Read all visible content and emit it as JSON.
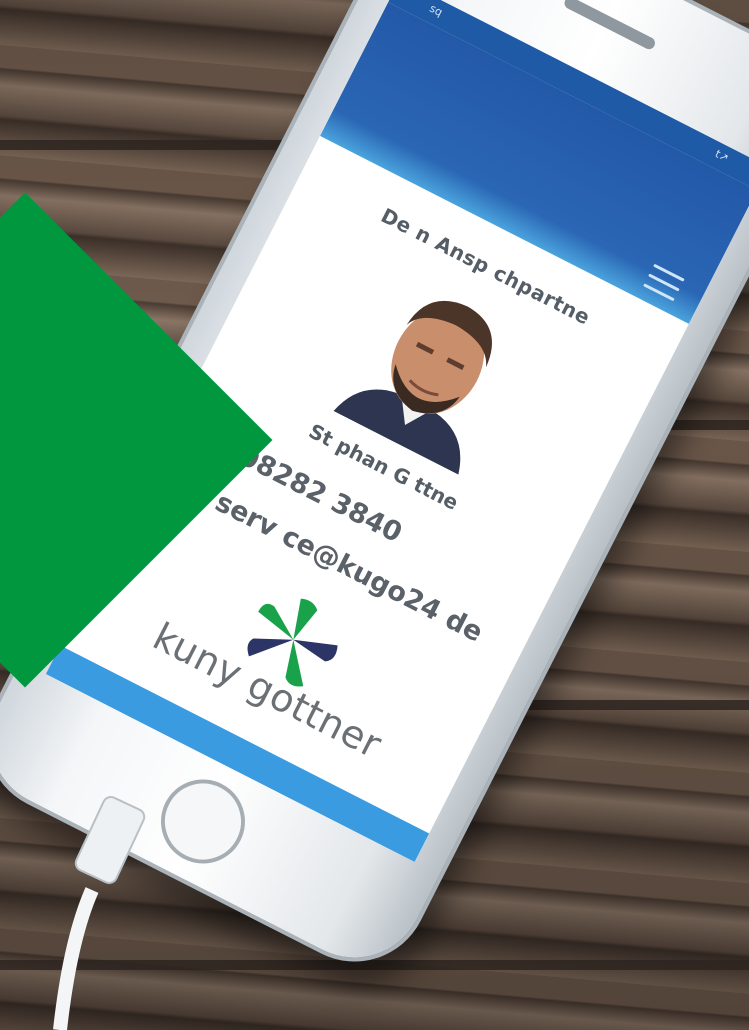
{
  "screen": {
    "status_left": "sq",
    "status_right": "t↗",
    "heading": "De n Ansp   chpartne",
    "person_name": "St phan G ttne",
    "phone": "08282 3840",
    "email": "serv ce@kugo24 de",
    "logo_text": "kuny gottner"
  },
  "icons": {
    "menu": "hamburger-menu-icon",
    "phone": "phone-icon",
    "email": "envelope-icon",
    "logo": "flower-logo-icon"
  },
  "colors": {
    "accent_green": "#00973f",
    "navbar_blue": "#2359a8",
    "footer_blue": "#3a9be0",
    "logo_green": "#1aa24a",
    "logo_navy": "#2c3566"
  }
}
